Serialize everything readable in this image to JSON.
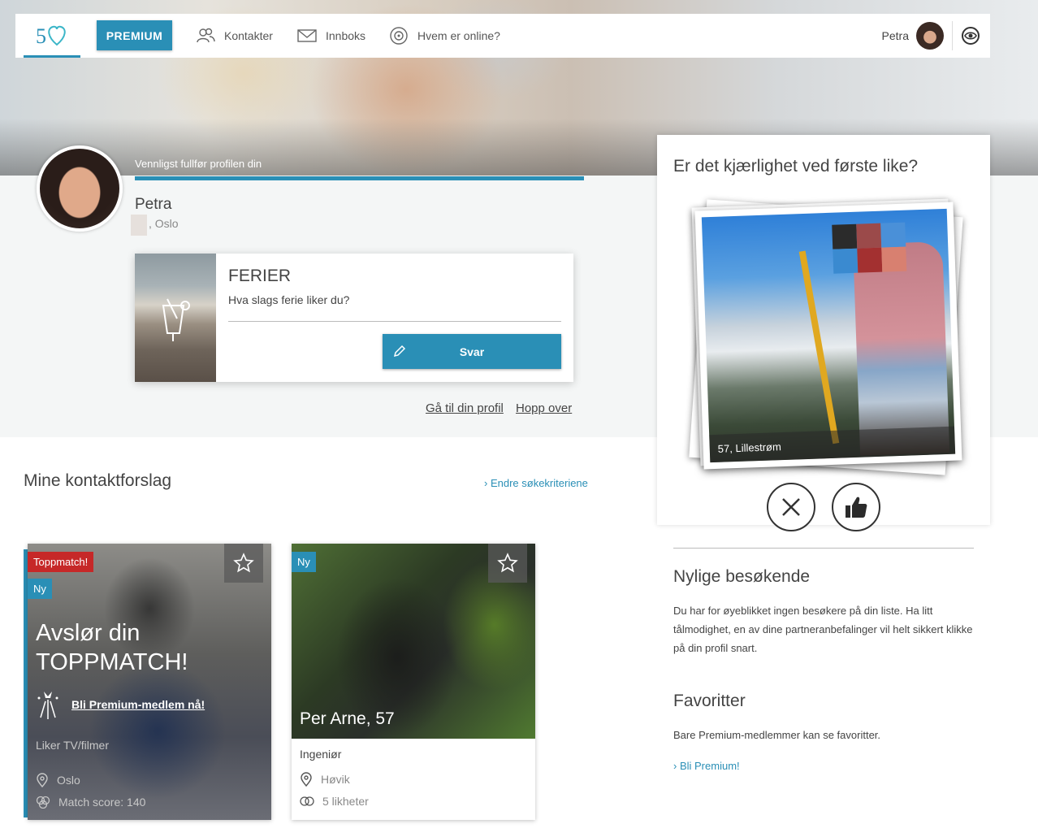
{
  "nav": {
    "premium_label": "PREMIUM",
    "contacts_label": "Kontakter",
    "inbox_label": "Innboks",
    "online_label": "Hvem er online?",
    "user_name": "Petra"
  },
  "profile": {
    "progress_title": "Vennligst fullfør profilen din",
    "progress_fraction": 1.0,
    "name": "Petra",
    "city": ", Oslo"
  },
  "question": {
    "title": "FERIER",
    "text": "Hva slags ferie liker du?",
    "answer_label": "Svar",
    "goto_profile": "Gå til din profil",
    "skip": "Hopp over"
  },
  "suggestions": {
    "title": "Mine kontaktforslag",
    "edit_link": "Endre søkekriteriene",
    "card1": {
      "badge_top": "Toppmatch!",
      "badge_new": "Ny",
      "reveal": "Avslør din TOPPMATCH!",
      "premium_link": "Bli Premium-medlem nå!",
      "interest": "Liker TV/filmer",
      "city": "Oslo",
      "score": "Match score: 140"
    },
    "card2": {
      "badge_new": "Ny",
      "name": "Per Arne, 57",
      "job": "Ingeniør",
      "city": "Høvik",
      "likes": "5 likheter"
    }
  },
  "like_game": {
    "title": "Er det kjærlighet ved første like?",
    "caption": "57, Lillestrøm"
  },
  "visitors": {
    "title": "Nylige besøkende",
    "text": "Du har for øyeblikket ingen besøkere på din liste. Ha litt tålmodighet, en av dine partneranbefalinger vil helt sikkert klikke på din profil snart."
  },
  "favorites": {
    "title": "Favoritter",
    "text": "Bare Premium-medlemmer kan se favoritter.",
    "link": "Bli Premium!"
  },
  "colors": {
    "accent": "#2a8fb6",
    "toppmatch": "#c62828"
  }
}
